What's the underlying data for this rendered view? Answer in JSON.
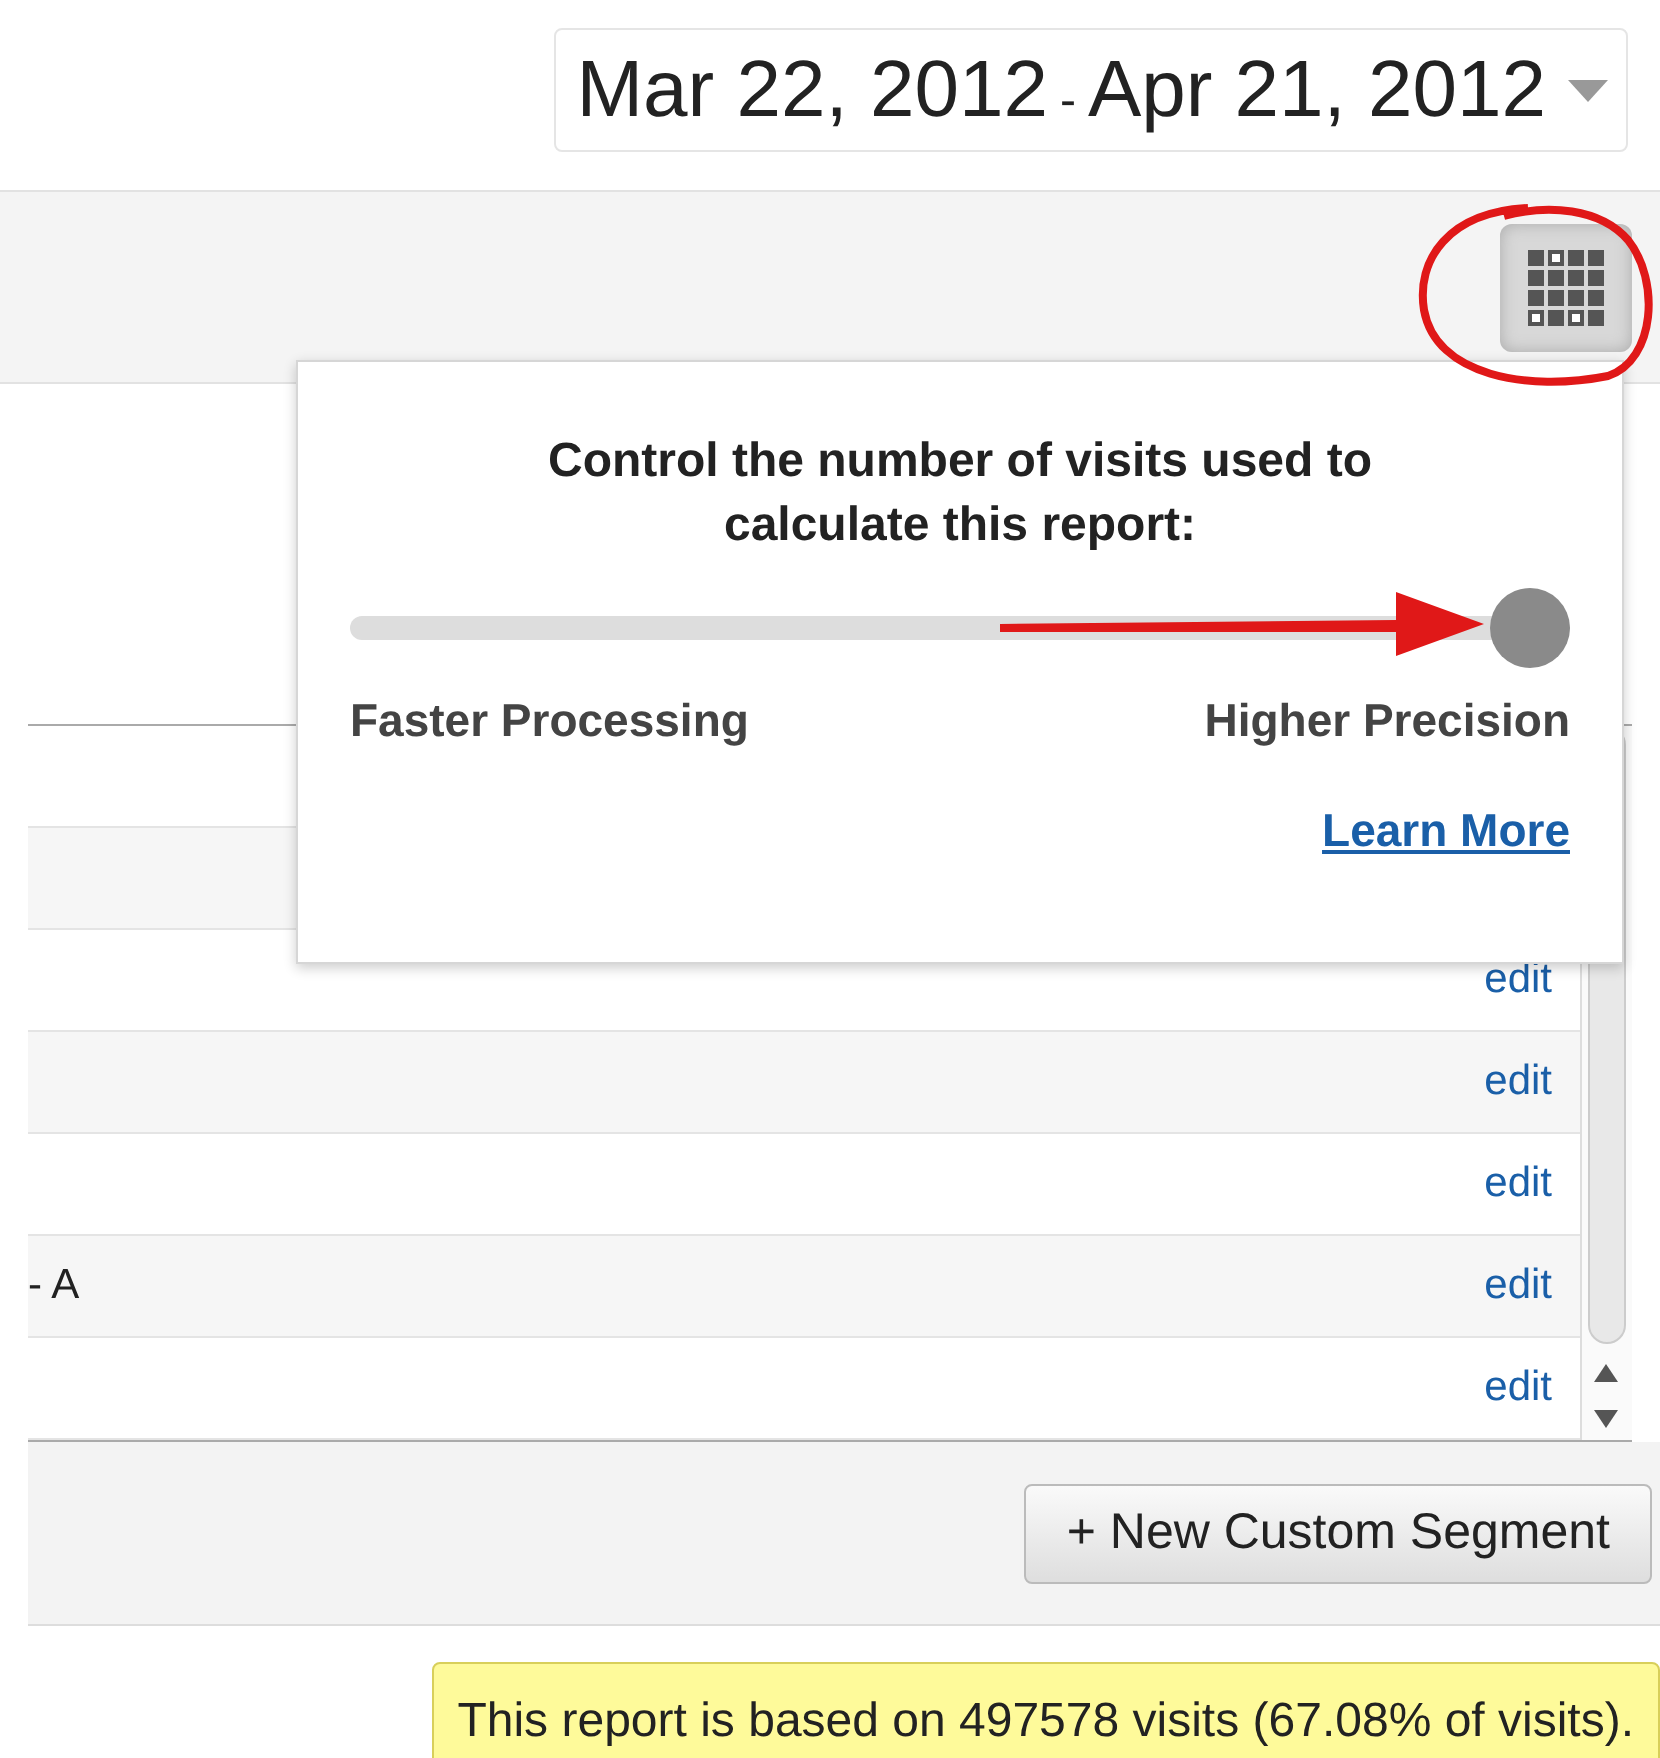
{
  "date_range": {
    "start": "Mar 22, 2012",
    "separator": "-",
    "end": "Apr 21, 2012"
  },
  "popup": {
    "title": "Control the number of visits used to calculate this report:",
    "slider": {
      "level": 1
    },
    "left_label": "Faster Processing",
    "right_label": "Higher Precision",
    "link": "Learn More"
  },
  "table": {
    "rows": [
      {
        "action": "edit"
      },
      {
        "action": "edit"
      },
      {
        "action": "edit"
      },
      {
        "name": "- A",
        "action": "edit"
      },
      {
        "action": "edit"
      }
    ]
  },
  "new_segment_button": "+ New Custom Segment",
  "notice": "This report is based on 497578 visits (67.08% of visits)."
}
